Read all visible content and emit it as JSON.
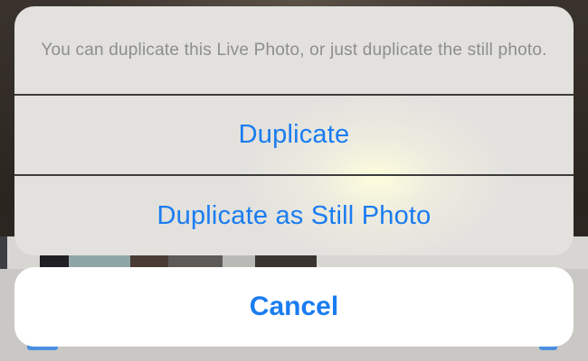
{
  "action_sheet": {
    "message": "You can duplicate this Live Photo, or just duplicate the still photo.",
    "actions": [
      {
        "label": "Duplicate"
      },
      {
        "label": "Duplicate as Still Photo"
      }
    ],
    "cancel_label": "Cancel"
  },
  "colors": {
    "action_text": "#1a7cf0",
    "message_text": "#8e8e8e",
    "sheet_background": "#e2e1de",
    "cancel_background": "#ffffff"
  }
}
